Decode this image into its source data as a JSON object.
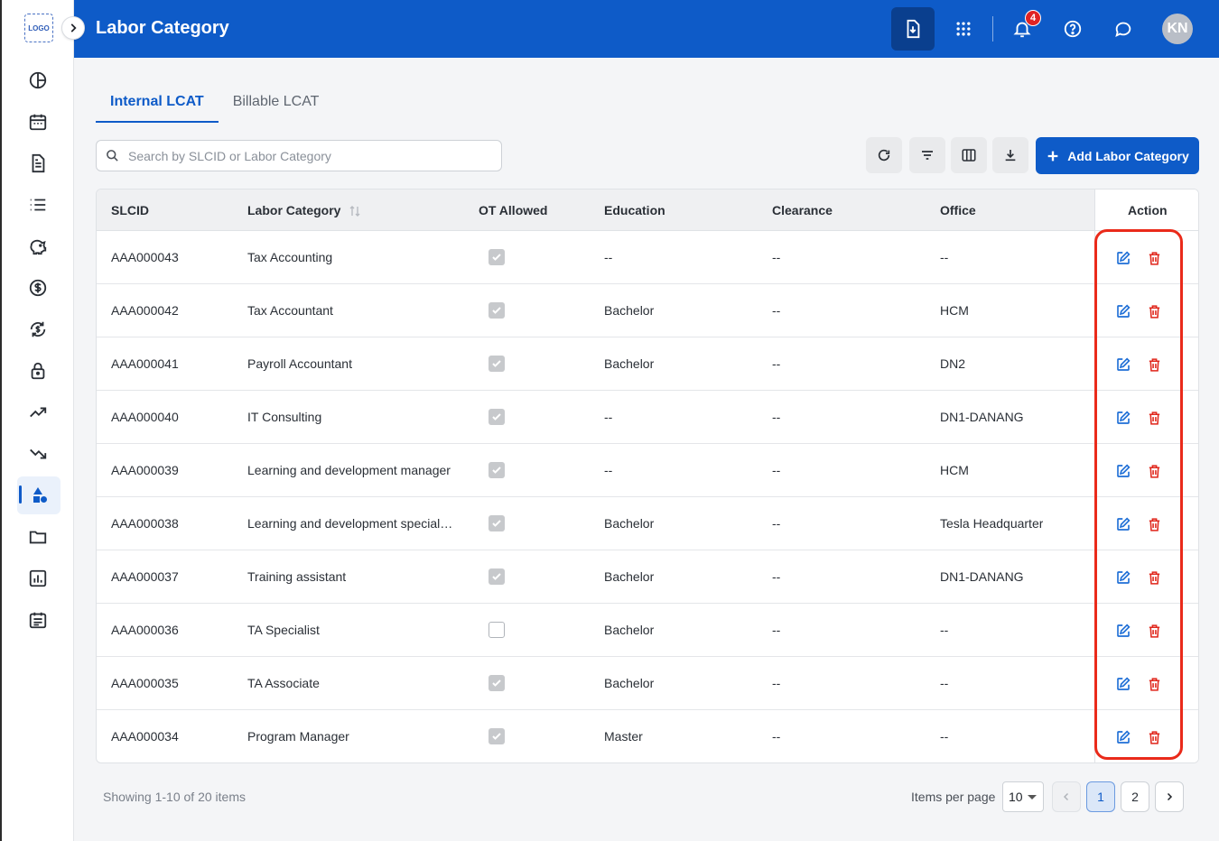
{
  "sidebar": {
    "logo_text": "LOGO",
    "items": [
      {
        "icon": "pie-chart-icon"
      },
      {
        "icon": "calendar-icon"
      },
      {
        "icon": "document-icon"
      },
      {
        "icon": "list-icon"
      },
      {
        "icon": "piggy-bank-icon"
      },
      {
        "icon": "dollar-icon"
      },
      {
        "icon": "currency-exchange-icon"
      },
      {
        "icon": "lock-icon"
      },
      {
        "icon": "trending-up-icon"
      },
      {
        "icon": "trending-down-icon"
      },
      {
        "icon": "shapes-icon",
        "active": true
      },
      {
        "icon": "folder-icon"
      },
      {
        "icon": "bar-chart-icon"
      },
      {
        "icon": "calendar-list-icon"
      }
    ]
  },
  "header": {
    "title": "Labor Category",
    "notification_count": "4",
    "avatar_initials": "KN"
  },
  "tabs": [
    {
      "label": "Internal LCAT",
      "active": true
    },
    {
      "label": "Billable LCAT",
      "active": false
    }
  ],
  "toolbar": {
    "search_placeholder": "Search by SLCID or Labor Category",
    "add_label": "Add Labor Category"
  },
  "table": {
    "columns": {
      "slcid": "SLCID",
      "labor_category": "Labor Category",
      "ot_allowed": "OT Allowed",
      "education": "Education",
      "clearance": "Clearance",
      "office": "Office",
      "action": "Action"
    },
    "rows": [
      {
        "slcid": "AAA000043",
        "labor_category": "Tax Accounting",
        "ot_allowed": true,
        "education": "--",
        "clearance": "--",
        "office": "--"
      },
      {
        "slcid": "AAA000042",
        "labor_category": "Tax Accountant",
        "ot_allowed": true,
        "education": "Bachelor",
        "clearance": "--",
        "office": "HCM"
      },
      {
        "slcid": "AAA000041",
        "labor_category": "Payroll Accountant",
        "ot_allowed": true,
        "education": "Bachelor",
        "clearance": "--",
        "office": "DN2"
      },
      {
        "slcid": "AAA000040",
        "labor_category": "IT Consulting",
        "ot_allowed": true,
        "education": "--",
        "clearance": "--",
        "office": "DN1-DANANG"
      },
      {
        "slcid": "AAA000039",
        "labor_category": "Learning and development manager",
        "ot_allowed": true,
        "education": "--",
        "clearance": "--",
        "office": "HCM"
      },
      {
        "slcid": "AAA000038",
        "labor_category": "Learning and development special…",
        "ot_allowed": true,
        "education": "Bachelor",
        "clearance": "--",
        "office": "Tesla Headquarter"
      },
      {
        "slcid": "AAA000037",
        "labor_category": "Training assistant",
        "ot_allowed": true,
        "education": "Bachelor",
        "clearance": "--",
        "office": "DN1-DANANG"
      },
      {
        "slcid": "AAA000036",
        "labor_category": "TA Specialist",
        "ot_allowed": false,
        "education": "Bachelor",
        "clearance": "--",
        "office": "--"
      },
      {
        "slcid": "AAA000035",
        "labor_category": "TA Associate",
        "ot_allowed": true,
        "education": "Bachelor",
        "clearance": "--",
        "office": "--"
      },
      {
        "slcid": "AAA000034",
        "labor_category": "Program Manager",
        "ot_allowed": true,
        "education": "Master",
        "clearance": "--",
        "office": "--"
      }
    ]
  },
  "footer": {
    "showing_text": "Showing 1-10 of 20 items",
    "items_per_page_label": "Items per page",
    "items_per_page_value": "10",
    "pages": [
      "1",
      "2"
    ],
    "current_page": "1"
  },
  "colors": {
    "brand": "#0e5bc8",
    "edit_icon": "#1f6fd6",
    "delete_icon": "#e0261b",
    "highlight": "#ea2a1a"
  }
}
